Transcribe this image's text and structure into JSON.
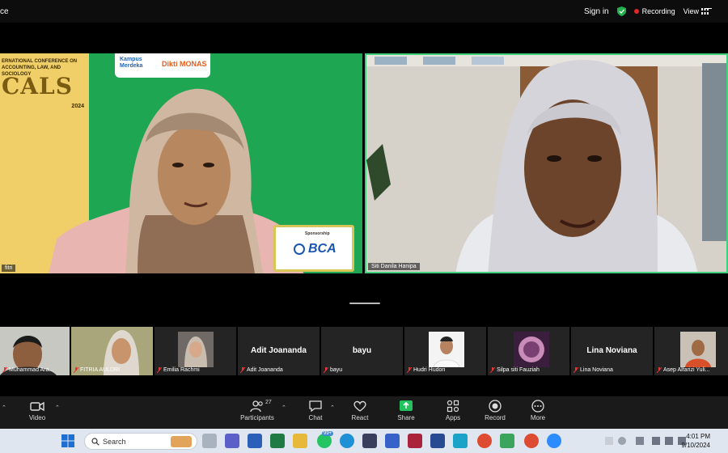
{
  "window": {
    "title": "ce",
    "sign_in": "Sign in",
    "recording": "Recording",
    "view": "View"
  },
  "speaker_tile": {
    "conference_text": "ERNATIONAL CONFERENCE ON ACCOUNTING, LAW, AND SOCIOLOGY",
    "conference_name": "CALS",
    "year": "2024",
    "logo_left": "Kampus Merdeka",
    "logo_right": "Dikti MONAS",
    "sponsor_label": "Sponsorship",
    "sponsor_name": "BCA",
    "label": "fitri"
  },
  "second_tile": {
    "label": "Siti Danila Hanipa"
  },
  "thumbnails": [
    {
      "label": "Muhammad Ara...",
      "type": "video"
    },
    {
      "label": "FITRIA AULDRI",
      "type": "video"
    },
    {
      "label": "Emilia Rachmi",
      "type": "avatar"
    },
    {
      "label": "Adit Joananda",
      "type": "name",
      "name_text": "Adit Joananda"
    },
    {
      "label": "bayu",
      "type": "name",
      "name_text": "bayu"
    },
    {
      "label": "Hudri Hudori",
      "type": "avatar"
    },
    {
      "label": "Silpa siti Fauziah",
      "type": "avatar"
    },
    {
      "label": "Lina Noviana",
      "type": "name",
      "name_text": "Lina Noviana"
    },
    {
      "label": "Asep Alfarizi Yuli...",
      "type": "avatar"
    }
  ],
  "toolbar": {
    "video": "Video",
    "participants": "Participants",
    "participants_count": "27",
    "chat": "Chat",
    "react": "React",
    "share": "Share",
    "apps": "Apps",
    "record": "Record",
    "more": "More"
  },
  "taskbar": {
    "search_placeholder": "Search",
    "time": "4:01 PM",
    "date": "9/10/2024",
    "whatsapp_badge": "99+"
  },
  "colors": {
    "share_green": "#22c35e",
    "active_border": "#3fd27a",
    "record_red": "#e02828"
  }
}
